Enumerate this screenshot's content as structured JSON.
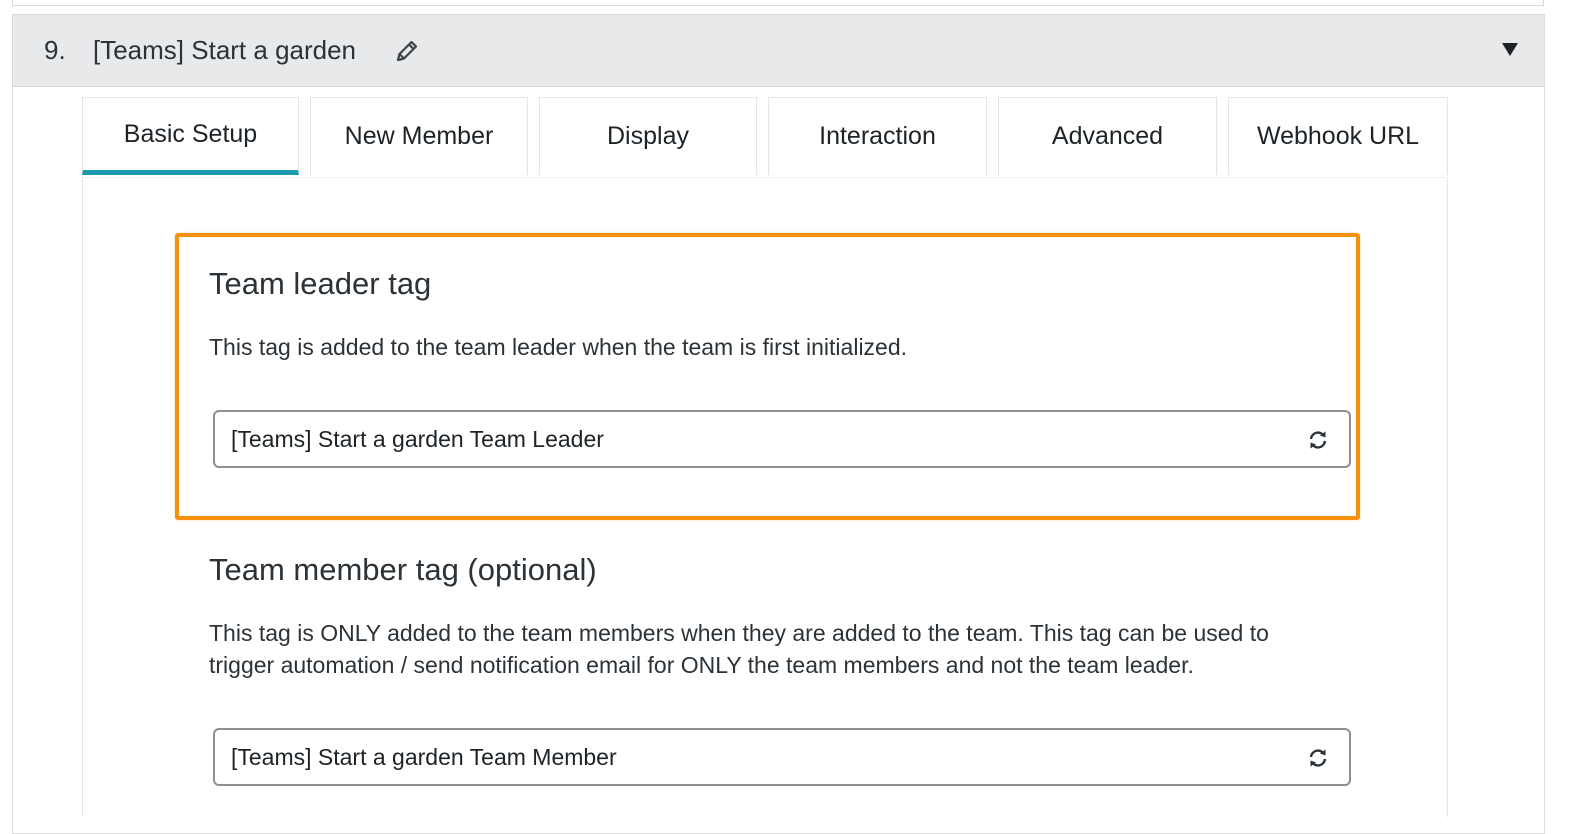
{
  "panel": {
    "number": "9.",
    "title": "[Teams] Start a garden",
    "edit_icon": "pencil-icon",
    "collapse_icon": "triangle-down-icon"
  },
  "tabs": [
    {
      "label": "Basic Setup",
      "active": true
    },
    {
      "label": "New Member",
      "active": false
    },
    {
      "label": "Display",
      "active": false
    },
    {
      "label": "Interaction",
      "active": false
    },
    {
      "label": "Advanced",
      "active": false
    },
    {
      "label": "Webhook URL",
      "active": false
    }
  ],
  "leader_tag": {
    "title": "Team leader tag",
    "description": "This tag is added to the team leader when the team is first initialized.",
    "value": "[Teams] Start a garden Team Leader",
    "icon": "refresh-icon"
  },
  "member_tag": {
    "title": "Team member tag (optional)",
    "description_line1": "This tag is ONLY added to the team members when they are added to the team. This tag can be used to",
    "description_line2": "trigger automation / send notification email for ONLY the team members and not the team leader.",
    "value": "[Teams] Start a garden Team Member",
    "icon": "refresh-icon"
  },
  "colors": {
    "active_tab_underline": "#1a9bb0",
    "highlight_border": "#f5910f",
    "header_bg": "#e8e9eb"
  }
}
